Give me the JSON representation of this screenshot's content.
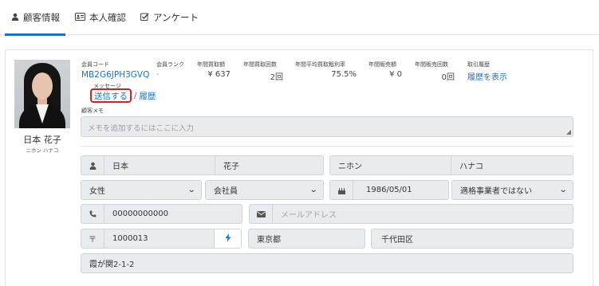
{
  "tabs": [
    {
      "label": "顧客情報",
      "icon": "user-icon",
      "active": true
    },
    {
      "label": "本人確認",
      "icon": "id-card-icon",
      "active": false
    },
    {
      "label": "アンケート",
      "icon": "checkbox-icon",
      "active": false
    }
  ],
  "customer": {
    "name": "日本 花子",
    "kana": "ニホン ハナコ"
  },
  "stats": {
    "member_code": {
      "label": "会員コード",
      "value": "MB2G6JPH3GVQ"
    },
    "member_rank": {
      "label": "会員ランク",
      "value": "-"
    },
    "annual_purchase_amount": {
      "label": "年間買取額",
      "value": "¥ 637"
    },
    "annual_purchase_count": {
      "label": "年間買取回数",
      "value": "2回"
    },
    "avg_gross_margin": {
      "label": "年間平均買取粗利率",
      "value": "75.5%"
    },
    "annual_sales_amount": {
      "label": "年間販売額",
      "value": "¥ 0"
    },
    "annual_sales_count": {
      "label": "年間販売回数",
      "value": "0回"
    },
    "history": {
      "label": "取引履歴",
      "value": "履歴を表示"
    }
  },
  "message": {
    "label": "メッセージ",
    "send": "送信する",
    "separator": "/",
    "history": "履歴"
  },
  "memo": {
    "label": "顧客メモ",
    "placeholder": "メモを追加するにはここに入力"
  },
  "form": {
    "last_name": "日本",
    "first_name": "花子",
    "last_name_kana": "ニホン",
    "first_name_kana": "ハナコ",
    "gender": "女性",
    "occupation": "会社員",
    "birthdate": "1986/05/01",
    "qualified_business": "適格事業者ではない",
    "phone": "00000000000",
    "email_placeholder": "メールアドレス",
    "postal_mark": "〒",
    "postal_code": "1000013",
    "prefecture": "東京都",
    "city": "千代田区",
    "address": "霞が関2-1-2"
  }
}
